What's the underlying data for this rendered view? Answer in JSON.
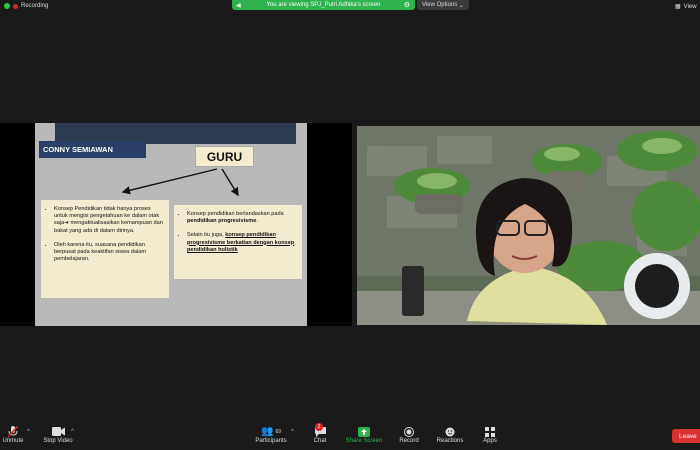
{
  "topbar": {
    "recording_label": "Recording",
    "viewing_text": "You are viewing SPJ_Putri Adhika's screen",
    "view_options_label": "View Options",
    "view_right_label": "View"
  },
  "slide": {
    "conny_label": "CONNY SEMIAWAN",
    "guru_label": "GURU",
    "left_bullets": [
      "Konsep Pendidikan tidak hanya proses untuk mengisi pengetahuan ke dalam otak saja➔ mengaktualisasikan kemampuan dan bakat yang ada di dalam dirinya.",
      "Oleh karena itu, suasana pendidikan berpusat pada keaktifan siswa dalam pembelajaran."
    ],
    "right_b1_prefix": "Konsep pendidikan berlandaskan pada ",
    "right_b1_bold": "pendidikan progresivisme",
    "right_b1_suffix": ".",
    "right_b2_prefix": "Selain itu juga, ",
    "right_b2_bold": "konsep pendidikan progresivisme berkaitan dengan konsep pendidikan holistik"
  },
  "toolbar": {
    "unmute": "Unmute",
    "stop_video": "Stop Video",
    "participants": "Participants",
    "participants_count": "69",
    "chat": "Chat",
    "chat_badge": "2",
    "share_screen": "Share Screen",
    "record": "Record",
    "reactions": "Reactions",
    "apps": "Apps",
    "leave": "Leave"
  },
  "colors": {
    "share_green": "#2fb24c",
    "leave_red": "#d92f2f",
    "slide_bg": "#b9b9b9",
    "box_bg": "#f3ecd1"
  }
}
